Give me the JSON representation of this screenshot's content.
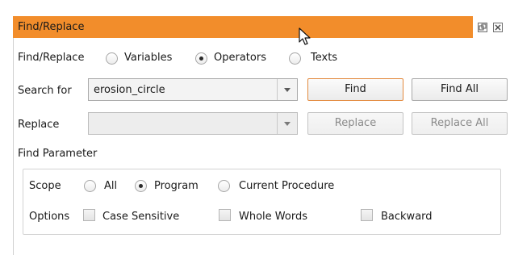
{
  "panel": {
    "title": "Find/Replace"
  },
  "find_mode": {
    "label": "Find/Replace",
    "options": [
      "Variables",
      "Operators",
      "Texts"
    ],
    "selected": "Operators"
  },
  "search": {
    "label": "Search for",
    "value": "erosion_circle",
    "find_button": "Find",
    "find_all_button": "Find All"
  },
  "replace": {
    "label": "Replace",
    "value": "",
    "replace_button": "Replace",
    "replace_all_button": "Replace All"
  },
  "find_parameter": {
    "heading": "Find Parameter",
    "scope_label": "Scope",
    "scope_options": [
      "All",
      "Program",
      "Current Procedure"
    ],
    "scope_selected": "Program",
    "options_label": "Options",
    "checkboxes": [
      {
        "label": "Case Sensitive",
        "checked": false
      },
      {
        "label": "Whole Words",
        "checked": false
      },
      {
        "label": "Backward",
        "checked": false
      }
    ]
  },
  "icons": {
    "float": "float-window-icon",
    "close": "close-window-icon",
    "cursor": "mouse-pointer-icon"
  },
  "colors": {
    "title_bar": "#f28d2b",
    "focused_button_border": "#e38a3e"
  }
}
